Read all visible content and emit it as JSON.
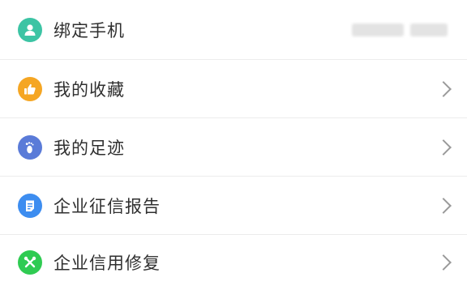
{
  "menu": {
    "items": [
      {
        "label": "绑定手机",
        "icon": "user-icon",
        "icon_color": "#3cc4a4",
        "value": "",
        "masked_value": true,
        "chevron": false
      },
      {
        "label": "我的收藏",
        "icon": "thumbs-up-icon",
        "icon_color": "#f5a623",
        "chevron": true
      },
      {
        "label": "我的足迹",
        "icon": "footprint-icon",
        "icon_color": "#5a7bd8",
        "chevron": true
      },
      {
        "label": "企业征信报告",
        "icon": "document-icon",
        "icon_color": "#3d8df0",
        "chevron": true
      },
      {
        "label": "企业信用修复",
        "icon": "wrench-icon",
        "icon_color": "#2fcb52",
        "chevron": true
      }
    ]
  }
}
